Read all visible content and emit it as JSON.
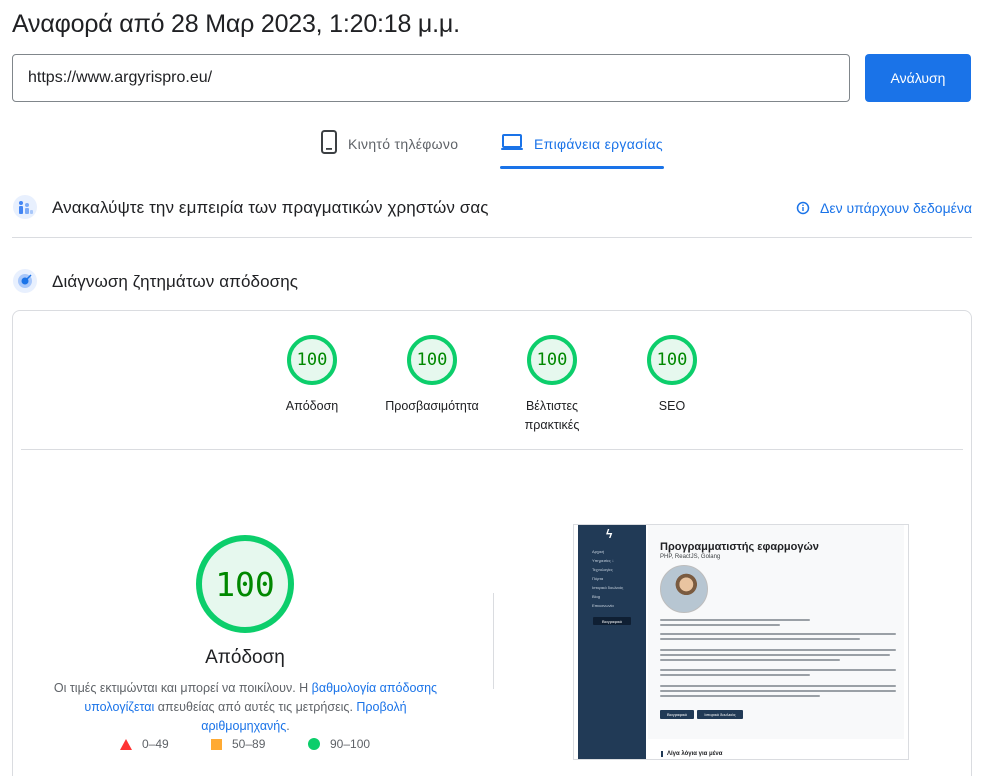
{
  "header": {
    "title": "Αναφορά από 28 Μαρ 2023, 1:20:18 μ.μ."
  },
  "search": {
    "url_value": "https://www.argyrispro.eu/",
    "analyze_label": "Ανάλυση"
  },
  "tabs": [
    {
      "label": "Κινητό τηλέφωνο",
      "icon": "smartphone-icon",
      "active": false
    },
    {
      "label": "Επιφάνεια εργασίας",
      "icon": "laptop-icon",
      "active": true
    }
  ],
  "crux": {
    "title": "Ανακαλύψτε την εμπειρία των πραγματικών χρηστών σας",
    "status": "Δεν υπάρχουν δεδομένα",
    "icon": "crux-users-icon"
  },
  "diagnose": {
    "title": "Διάγνωση ζητημάτων απόδοσης",
    "icon": "lighthouse-icon"
  },
  "scores": [
    {
      "value": "100",
      "label": "Απόδοση"
    },
    {
      "value": "100",
      "label": "Προσβασιμότητα"
    },
    {
      "value": "100",
      "label_line1": "Βέλτιστες",
      "label_line2": "πρακτικές"
    },
    {
      "value": "100",
      "label": "SEO"
    }
  ],
  "performance": {
    "score": "100",
    "label": "Απόδοση",
    "note_prefix": "Οι τιμές εκτιμώνται και μπορεί να ποικίλουν. Η ",
    "note_link1": "βαθμολογία απόδοσης υπολογίζεται",
    "note_middle": " απευθείας από αυτές τις μετρήσεις. ",
    "note_link2": "Προβολή αριθμομηχανής",
    "note_suffix": "."
  },
  "legend": {
    "fail": "0–49",
    "average": "50–89",
    "pass": "90–100"
  },
  "colors": {
    "accent": "#1a73e8",
    "pass": "#0cce6b",
    "average": "#ffaa33",
    "fail": "#ff3333",
    "sidebar": "#213a56"
  },
  "screenshot": {
    "heading": "Προγραμματιστής εφαρμογών",
    "subheading": "PHP, ReactJS, Golang",
    "nav": [
      "Αρχική",
      "Υπηρεσίες ↓",
      "Τεχνολογίες",
      "Πόρτα",
      "Ιστορικό δουλειάς",
      "Blog",
      "Επικοινωνία"
    ],
    "nav_button": "Βιογραφικό",
    "btn_cv": "Βιογραφικό",
    "btn_projects": "Ιστορικό δουλειάς",
    "footer_heading": "Λίγα λόγια για μένα"
  }
}
